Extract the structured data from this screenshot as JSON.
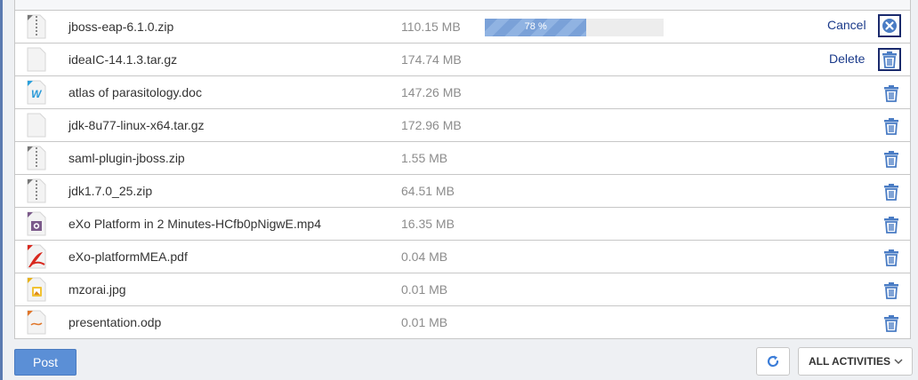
{
  "files": [
    {
      "name": "jboss-eap-6.1.0.zip",
      "size": "110.15 MB",
      "icon": "zip-file-icon",
      "state": "uploading",
      "progress_percent": 78,
      "progress_label": "78 %",
      "action_label": "Cancel"
    },
    {
      "name": "ideaIC-14.1.3.tar.gz",
      "size": "174.74 MB",
      "icon": "generic-file-icon",
      "state": "selected",
      "action_label": "Delete"
    },
    {
      "name": "atlas of parasitology.doc",
      "size": "147.26 MB",
      "icon": "word-document-icon",
      "state": "done"
    },
    {
      "name": "jdk-8u77-linux-x64.tar.gz",
      "size": "172.96 MB",
      "icon": "generic-file-icon",
      "state": "done"
    },
    {
      "name": "saml-plugin-jboss.zip",
      "size": "1.55 MB",
      "icon": "zip-file-icon",
      "state": "done"
    },
    {
      "name": "jdk1.7.0_25.zip",
      "size": "64.51 MB",
      "icon": "zip-file-icon",
      "state": "done"
    },
    {
      "name": "eXo Platform in 2 Minutes-HCfb0pNigwE.mp4",
      "size": "16.35 MB",
      "icon": "video-file-icon",
      "state": "done"
    },
    {
      "name": "eXo-platformMEA.pdf",
      "size": "0.04 MB",
      "icon": "pdf-file-icon",
      "state": "done"
    },
    {
      "name": "mzorai.jpg",
      "size": "0.01 MB",
      "icon": "image-file-icon",
      "state": "done"
    },
    {
      "name": "presentation.odp",
      "size": "0.01 MB",
      "icon": "presentation-file-icon",
      "state": "done"
    }
  ],
  "footer": {
    "post_label": "Post",
    "filter_label": "ALL ACTIVITIES"
  },
  "colors": {
    "accent": "#5b8fd6",
    "trash_icon": "#4a7cc4",
    "link": "#1a3a8a",
    "size_text": "#8c8c8c"
  }
}
